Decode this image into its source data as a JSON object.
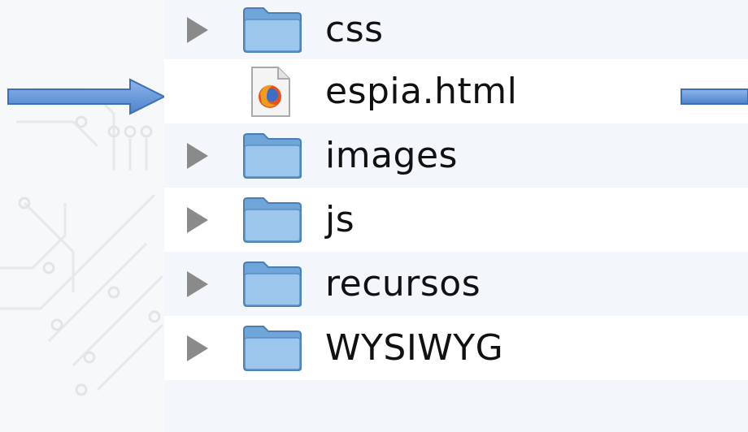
{
  "finder": {
    "items": [
      {
        "label": "css",
        "kind": "folder",
        "expandable": true
      },
      {
        "label": "espia.html",
        "kind": "file",
        "expandable": false
      },
      {
        "label": "images",
        "kind": "folder",
        "expandable": true
      },
      {
        "label": "js",
        "kind": "folder",
        "expandable": true
      },
      {
        "label": "recursos",
        "kind": "folder",
        "expandable": true
      },
      {
        "label": "WYSIWYG",
        "kind": "folder",
        "expandable": true
      }
    ]
  },
  "colors": {
    "arrow": "#5b8fd6",
    "folder": "#7fb0df",
    "row_alt": "#f3f6fa",
    "disclosure": "#8a8a8a"
  },
  "icons": {
    "disclosure": "disclosure-triangle-icon",
    "folder": "folder-icon",
    "file": "firefox-html-file-icon",
    "arrow": "arrow-right-icon"
  }
}
